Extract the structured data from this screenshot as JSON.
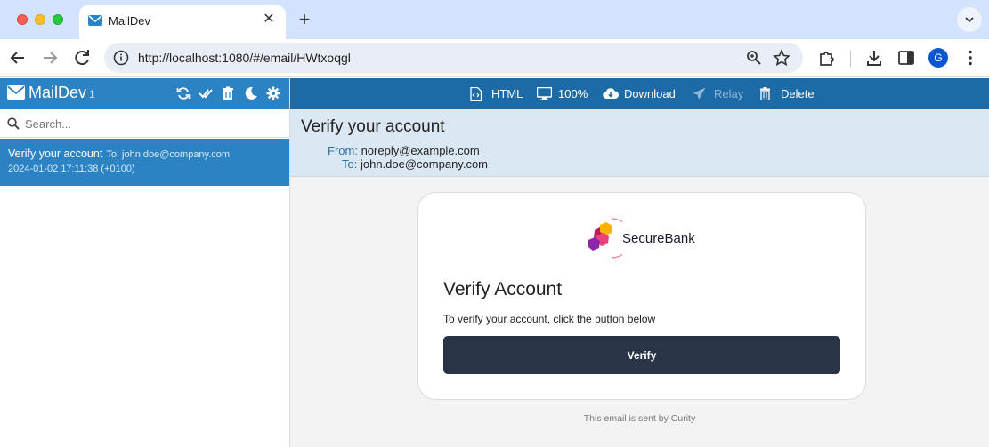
{
  "browser": {
    "tab_title": "MailDev",
    "url": "http://localhost:1080/#/email/HWtxoqgl",
    "profile_initial": "G",
    "icons": [
      "back-icon",
      "forward-icon",
      "reload-icon",
      "info-icon",
      "zoom-icon",
      "star-icon",
      "extensions-icon",
      "download-icon",
      "sidebar-icon",
      "menu-icon"
    ]
  },
  "app": {
    "name": "MailDev",
    "count": "1",
    "search_placeholder": "Search...",
    "emails": [
      {
        "subject": "Verify your account",
        "to": "To: john.doe@company.com",
        "date": "2024-01-02 17:11:38 (+0100)"
      }
    ],
    "toolbar": {
      "html": "HTML",
      "zoom": "100%",
      "download": "Download",
      "relay": "Relay",
      "delete": "Delete"
    },
    "message": {
      "subject": "Verify your account",
      "from_label": "From:",
      "from": "noreply@example.com",
      "to_label": "To:",
      "to": "john.doe@company.com"
    },
    "email_content": {
      "brand": "SecureBank",
      "title": "Verify Account",
      "text": "To verify your account, click the button below",
      "button": "Verify",
      "footer": "This email is sent by Curity"
    }
  },
  "colors": {
    "sidebar_header": "#2c83c3",
    "main_toolbar": "#1c6aa6",
    "selected_item": "#2c83c3",
    "verify_button": "#2a3447"
  }
}
